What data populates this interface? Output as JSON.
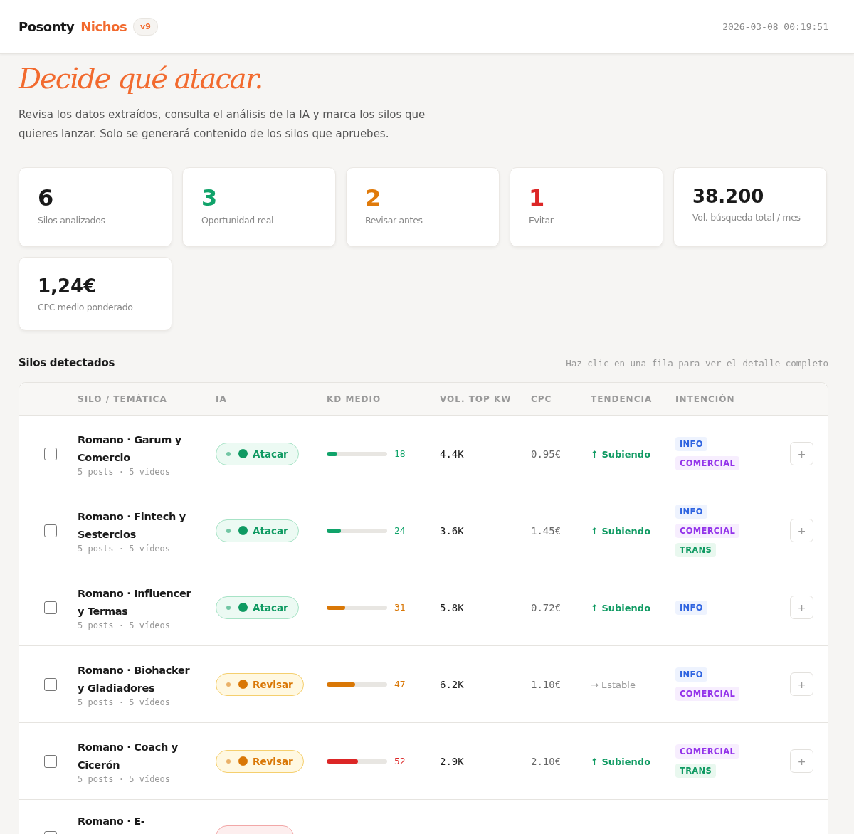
{
  "header": {
    "brand": "Posonty",
    "product": "Nichos",
    "version": "v9",
    "timestamp": "2026-03-08 00:19:51"
  },
  "hero": {
    "title": "Decide qué atacar.",
    "subtitle": "Revisa los datos extraídos, consulta el análisis de la IA y marca los silos que quieres lanzar. Solo se generará contenido de los silos que apruebes."
  },
  "stats": [
    {
      "value": "6",
      "label": "Silos analizados",
      "kind": "neutral"
    },
    {
      "value": "3",
      "label": "Oportunidad real",
      "kind": "good"
    },
    {
      "value": "2",
      "label": "Revisar antes",
      "kind": "warn"
    },
    {
      "value": "1",
      "label": "Evitar",
      "kind": "bad"
    },
    {
      "value": "38.200",
      "label": "Vol. búsqueda total / mes",
      "kind": "neutral"
    },
    {
      "value": "1,24€",
      "label": "CPC medio ponderado",
      "kind": "neutral"
    }
  ],
  "table": {
    "title": "Silos detectados",
    "hint": "Haz clic en una fila para ver el detalle completo",
    "columns": [
      "SILO / TEMÁTICA",
      "IA",
      "KD MEDIO",
      "VOL. TOP KW",
      "CPC",
      "TENDENCIA",
      "INTENCIÓN"
    ],
    "rows": [
      {
        "checked": false,
        "name": "Romano · Garum y Comercio",
        "meta": "5 posts · 5 vídeos",
        "ia": {
          "kind": "atacar",
          "label": "Atacar"
        },
        "kd": {
          "value": "18",
          "level": 0.18,
          "kind": "low"
        },
        "volume": "4.4K",
        "cpc": "0.95€",
        "trend": {
          "kind": "up",
          "text": "↑ Subiendo"
        },
        "intents": [
          {
            "kind": "info",
            "label": "INFO"
          },
          {
            "kind": "comercial",
            "label": "COMERCIAL"
          }
        ],
        "action": "+"
      },
      {
        "checked": false,
        "name": "Romano · Fintech y Sestercios",
        "meta": "5 posts · 5 vídeos",
        "ia": {
          "kind": "atacar",
          "label": "Atacar"
        },
        "kd": {
          "value": "24",
          "level": 0.24,
          "kind": "low"
        },
        "volume": "3.6K",
        "cpc": "1.45€",
        "trend": {
          "kind": "up",
          "text": "↑ Subiendo"
        },
        "intents": [
          {
            "kind": "info",
            "label": "INFO"
          },
          {
            "kind": "comercial",
            "label": "COMERCIAL"
          },
          {
            "kind": "trans",
            "label": "TRANS"
          }
        ],
        "action": "+"
      },
      {
        "checked": false,
        "name": "Romano · Influencer y Termas",
        "meta": "5 posts · 5 vídeos",
        "ia": {
          "kind": "atacar",
          "label": "Atacar"
        },
        "kd": {
          "value": "31",
          "level": 0.31,
          "kind": "mid"
        },
        "volume": "5.8K",
        "cpc": "0.72€",
        "trend": {
          "kind": "up",
          "text": "↑ Subiendo"
        },
        "intents": [
          {
            "kind": "info",
            "label": "INFO"
          }
        ],
        "action": "+"
      },
      {
        "checked": false,
        "name": "Romano · Biohacker y Gladiadores",
        "meta": "5 posts · 5 vídeos",
        "ia": {
          "kind": "revisar",
          "label": "Revisar"
        },
        "kd": {
          "value": "47",
          "level": 0.47,
          "kind": "mid"
        },
        "volume": "6.2K",
        "cpc": "1.10€",
        "trend": {
          "kind": "flat",
          "text": "→ Estable"
        },
        "intents": [
          {
            "kind": "info",
            "label": "INFO"
          },
          {
            "kind": "comercial",
            "label": "COMERCIAL"
          }
        ],
        "action": "+"
      },
      {
        "checked": false,
        "name": "Romano · Coach y Cicerón",
        "meta": "5 posts · 5 vídeos",
        "ia": {
          "kind": "revisar",
          "label": "Revisar"
        },
        "kd": {
          "value": "52",
          "level": 0.52,
          "kind": "high"
        },
        "volume": "2.9K",
        "cpc": "2.10€",
        "trend": {
          "kind": "up",
          "text": "↑ Subiendo"
        },
        "intents": [
          {
            "kind": "comercial",
            "label": "COMERCIAL"
          },
          {
            "kind": "trans",
            "label": "TRANS"
          }
        ],
        "action": "+"
      },
      {
        "checked": false,
        "name": "Romano · E-",
        "ia": {
          "kind": "evitar"
        }
      }
    ]
  }
}
